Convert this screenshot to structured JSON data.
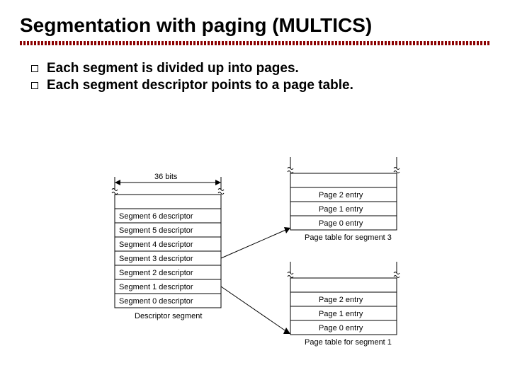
{
  "title": "Segmentation with paging (MULTICS)",
  "bullets": [
    "Each segment is divided up into pages.",
    "Each segment descriptor points to a page table."
  ],
  "diagram": {
    "width_label": "36 bits",
    "descriptor_caption": "Descriptor segment",
    "descriptor_rows": [
      "Segment 6 descriptor",
      "Segment 5 descriptor",
      "Segment 4 descriptor",
      "Segment 3 descriptor",
      "Segment 2 descriptor",
      "Segment 1 descriptor",
      "Segment 0 descriptor"
    ],
    "page_tables": [
      {
        "caption": "Page table for segment 3",
        "rows": [
          "Page 2 entry",
          "Page 1 entry",
          "Page 0 entry"
        ]
      },
      {
        "caption": "Page table for segment 1",
        "rows": [
          "Page 2 entry",
          "Page 1 entry",
          "Page 0 entry"
        ]
      }
    ]
  }
}
